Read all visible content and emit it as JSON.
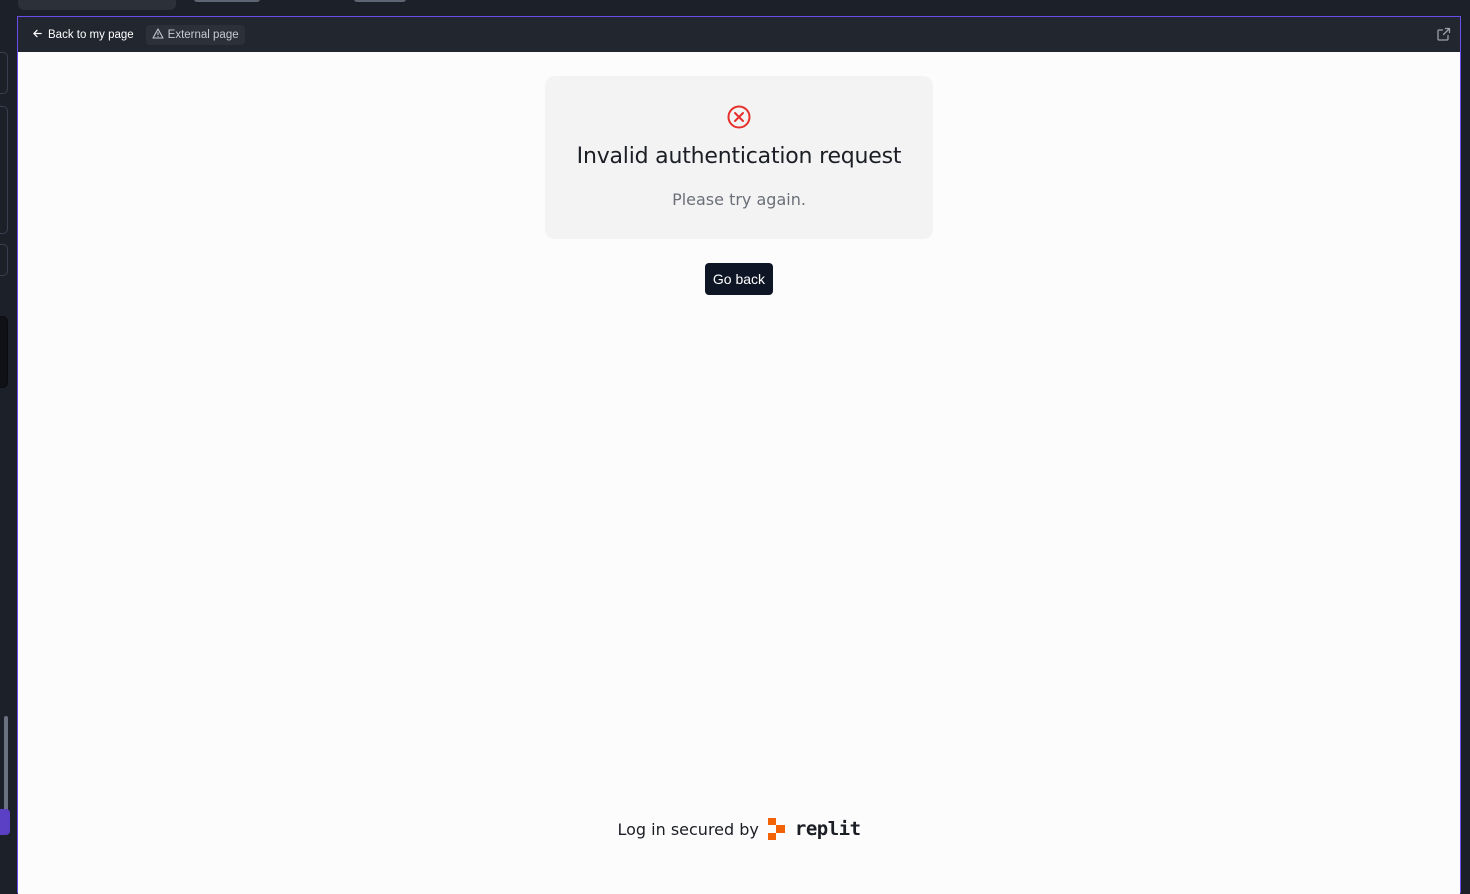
{
  "urlbar": {
    "back_label": "Back to my page",
    "external_label": "External page"
  },
  "card": {
    "title": "Invalid authentication request",
    "subtitle": "Please try again."
  },
  "actions": {
    "go_back_label": "Go back"
  },
  "footer": {
    "secured_text": "Log in secured by",
    "brand": "replit"
  },
  "colors": {
    "accent": "#6a4df0",
    "error": "#e5302b",
    "replit_orange": "#f26207",
    "button_bg": "#0e1525"
  }
}
